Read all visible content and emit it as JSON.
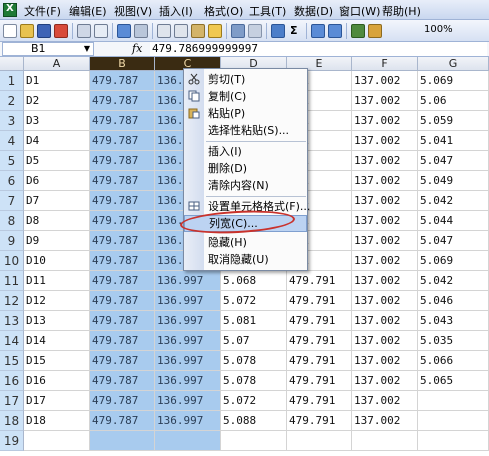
{
  "menubar": {
    "items": [
      "文件(F)",
      "编辑(E)",
      "视图(V)",
      "插入(I)",
      "格式(O)",
      "工具(T)",
      "数据(D)",
      "窗口(W)",
      "帮助(H)"
    ]
  },
  "toolbar": {
    "sum_label": "Σ",
    "zoom": "100%"
  },
  "formula_bar": {
    "cell_ref": "B1",
    "fx_label": "fx",
    "formula": "479.786999999997"
  },
  "grid": {
    "columns": [
      "A",
      "B",
      "C",
      "D",
      "E",
      "F",
      "G"
    ],
    "selected_columns": [
      "B",
      "C"
    ],
    "rows": [
      {
        "num": "1",
        "cells": [
          "D1",
          "479.787",
          "136.",
          "",
          "791",
          "137.002",
          "5.069"
        ]
      },
      {
        "num": "2",
        "cells": [
          "D2",
          "479.787",
          "136.",
          "",
          "791",
          "137.002",
          "5.06"
        ]
      },
      {
        "num": "3",
        "cells": [
          "D3",
          "479.787",
          "136.",
          "",
          "791",
          "137.002",
          "5.059"
        ]
      },
      {
        "num": "4",
        "cells": [
          "D4",
          "479.787",
          "136.",
          "",
          "791",
          "137.002",
          "5.041"
        ]
      },
      {
        "num": "5",
        "cells": [
          "D5",
          "479.787",
          "136.",
          "",
          "791",
          "137.002",
          "5.047"
        ]
      },
      {
        "num": "6",
        "cells": [
          "D6",
          "479.787",
          "136.",
          "",
          "791",
          "137.002",
          "5.049"
        ]
      },
      {
        "num": "7",
        "cells": [
          "D7",
          "479.787",
          "136.",
          "",
          "791",
          "137.002",
          "5.042"
        ]
      },
      {
        "num": "8",
        "cells": [
          "D8",
          "479.787",
          "136.",
          "",
          "791",
          "137.002",
          "5.044"
        ]
      },
      {
        "num": "9",
        "cells": [
          "D9",
          "479.787",
          "136.",
          "",
          "791",
          "137.002",
          "5.047"
        ]
      },
      {
        "num": "10",
        "cells": [
          "D10",
          "479.787",
          "136.",
          "",
          "791",
          "137.002",
          "5.069"
        ]
      },
      {
        "num": "11",
        "cells": [
          "D11",
          "479.787",
          "136.997",
          "5.068",
          "479.791",
          "137.002",
          "5.042"
        ]
      },
      {
        "num": "12",
        "cells": [
          "D12",
          "479.787",
          "136.997",
          "5.072",
          "479.791",
          "137.002",
          "5.046"
        ]
      },
      {
        "num": "13",
        "cells": [
          "D13",
          "479.787",
          "136.997",
          "5.081",
          "479.791",
          "137.002",
          "5.043"
        ]
      },
      {
        "num": "14",
        "cells": [
          "D14",
          "479.787",
          "136.997",
          "5.07",
          "479.791",
          "137.002",
          "5.035"
        ]
      },
      {
        "num": "15",
        "cells": [
          "D15",
          "479.787",
          "136.997",
          "5.078",
          "479.791",
          "137.002",
          "5.066"
        ]
      },
      {
        "num": "16",
        "cells": [
          "D16",
          "479.787",
          "136.997",
          "5.078",
          "479.791",
          "137.002",
          "5.065"
        ]
      },
      {
        "num": "17",
        "cells": [
          "D17",
          "479.787",
          "136.997",
          "5.072",
          "479.791",
          "137.002",
          ""
        ]
      },
      {
        "num": "18",
        "cells": [
          "D18",
          "479.787",
          "136.997",
          "5.088",
          "479.791",
          "137.002",
          ""
        ]
      },
      {
        "num": "19",
        "cells": [
          "",
          "",
          "",
          "",
          "",
          "",
          ""
        ]
      }
    ]
  },
  "context_menu": {
    "items": [
      {
        "label": "剪切(T)",
        "icon": "scissors-icon"
      },
      {
        "label": "复制(C)",
        "icon": "copy-icon"
      },
      {
        "label": "粘贴(P)",
        "icon": "paste-icon"
      },
      {
        "label": "选择性粘贴(S)...",
        "icon": ""
      },
      {
        "label": "插入(I)",
        "icon": ""
      },
      {
        "label": "删除(D)",
        "icon": ""
      },
      {
        "label": "清除内容(N)",
        "icon": ""
      },
      {
        "label": "设置单元格格式(F)...",
        "icon": "format-cells-icon"
      },
      {
        "label": "列宽(C)...",
        "icon": ""
      },
      {
        "label": "隐藏(H)",
        "icon": ""
      },
      {
        "label": "取消隐藏(U)",
        "icon": ""
      }
    ],
    "highlighted": "列宽(C)..."
  },
  "colors": {
    "selection": "#a8cbee",
    "selected_header": "#3a2b12",
    "annotation_ring": "#c9322c"
  }
}
